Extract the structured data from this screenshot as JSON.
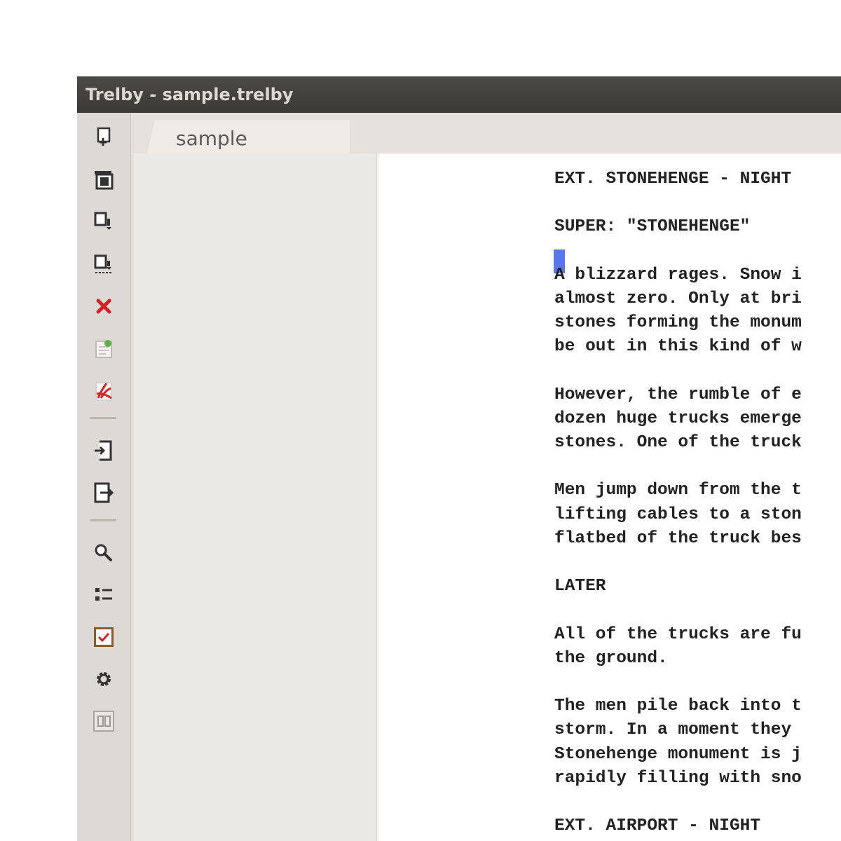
{
  "window": {
    "title": "Trelby - sample.trelby"
  },
  "toolbar": {
    "buttons": [
      {
        "name": "new-script-icon"
      },
      {
        "name": "open-script-icon"
      },
      {
        "name": "save-script-icon"
      },
      {
        "name": "save-as-icon"
      },
      {
        "name": "close-script-icon"
      },
      {
        "name": "revert-script-icon"
      },
      {
        "name": "export-pdf-icon"
      },
      {
        "name": "import-icon"
      },
      {
        "name": "export-icon"
      },
      {
        "name": "find-replace-icon"
      },
      {
        "name": "report-list-icon"
      },
      {
        "name": "spellcheck-icon"
      },
      {
        "name": "settings-gear-icon"
      },
      {
        "name": "compare-scripts-icon"
      }
    ]
  },
  "tabs": [
    {
      "label": "sample"
    }
  ],
  "script": {
    "lines": [
      "EXT. STONEHENGE - NIGHT",
      "",
      "SUPER: \"STONEHENGE\"",
      "",
      "A blizzard rages. Snow i",
      "almost zero. Only at bri",
      "stones forming the monum",
      "be out in this kind of w",
      "",
      "However, the rumble of e",
      "dozen huge trucks emerge",
      "stones. One of the truck",
      "",
      "Men jump down from the t",
      "lifting cables to a ston",
      "flatbed of the truck bes",
      "",
      "LATER",
      "",
      "All of the trucks are fu",
      "the ground.",
      "",
      "The men pile back into t",
      "storm. In a moment they",
      "Stonehenge monument is j",
      "rapidly filling with sno",
      "",
      "EXT. AIRPORT - NIGHT"
    ]
  },
  "colors": {
    "titlebar": "#3b3a36",
    "cursor": "#3d5fe6",
    "close_icon": "#d42121"
  }
}
